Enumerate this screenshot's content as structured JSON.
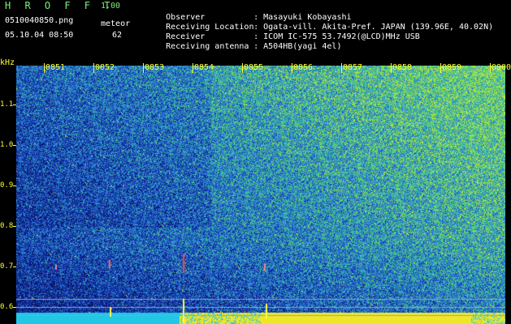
{
  "app": {
    "title": "H R O F F T",
    "version": "1.00"
  },
  "capture": {
    "filename": "0510040850.png",
    "mode_label": "meteor",
    "datetime": "05.10.04 08:50",
    "count": "62"
  },
  "info": [
    {
      "label": "Observer",
      "value": "Masayuki Kobayashi"
    },
    {
      "label": "Receiving Location",
      "value": "Ogata-vill. Akita-Pref. JAPAN (139.96E, 40.02N)"
    },
    {
      "label": "Receiver",
      "value": "ICOM IC-575 53.7492(@LCD)MHz USB"
    },
    {
      "label": "Receiving antenna",
      "value": "A504HB(yagi 4el)"
    }
  ],
  "axes": {
    "y_unit": "kHz",
    "y_ticks": [
      "1.1",
      "1.0",
      "0.9",
      "0.8",
      "0.7",
      "0.6"
    ],
    "time_ticks": [
      "0851",
      "0852",
      "0853",
      "0854",
      "0855",
      "0856",
      "0857",
      "0858",
      "0859",
      "0900"
    ]
  },
  "colors": {
    "background": "#000000",
    "label_green": "#7cf07c",
    "axis_yellow": "#ffff30",
    "plot_blue": "#0c1468"
  }
}
